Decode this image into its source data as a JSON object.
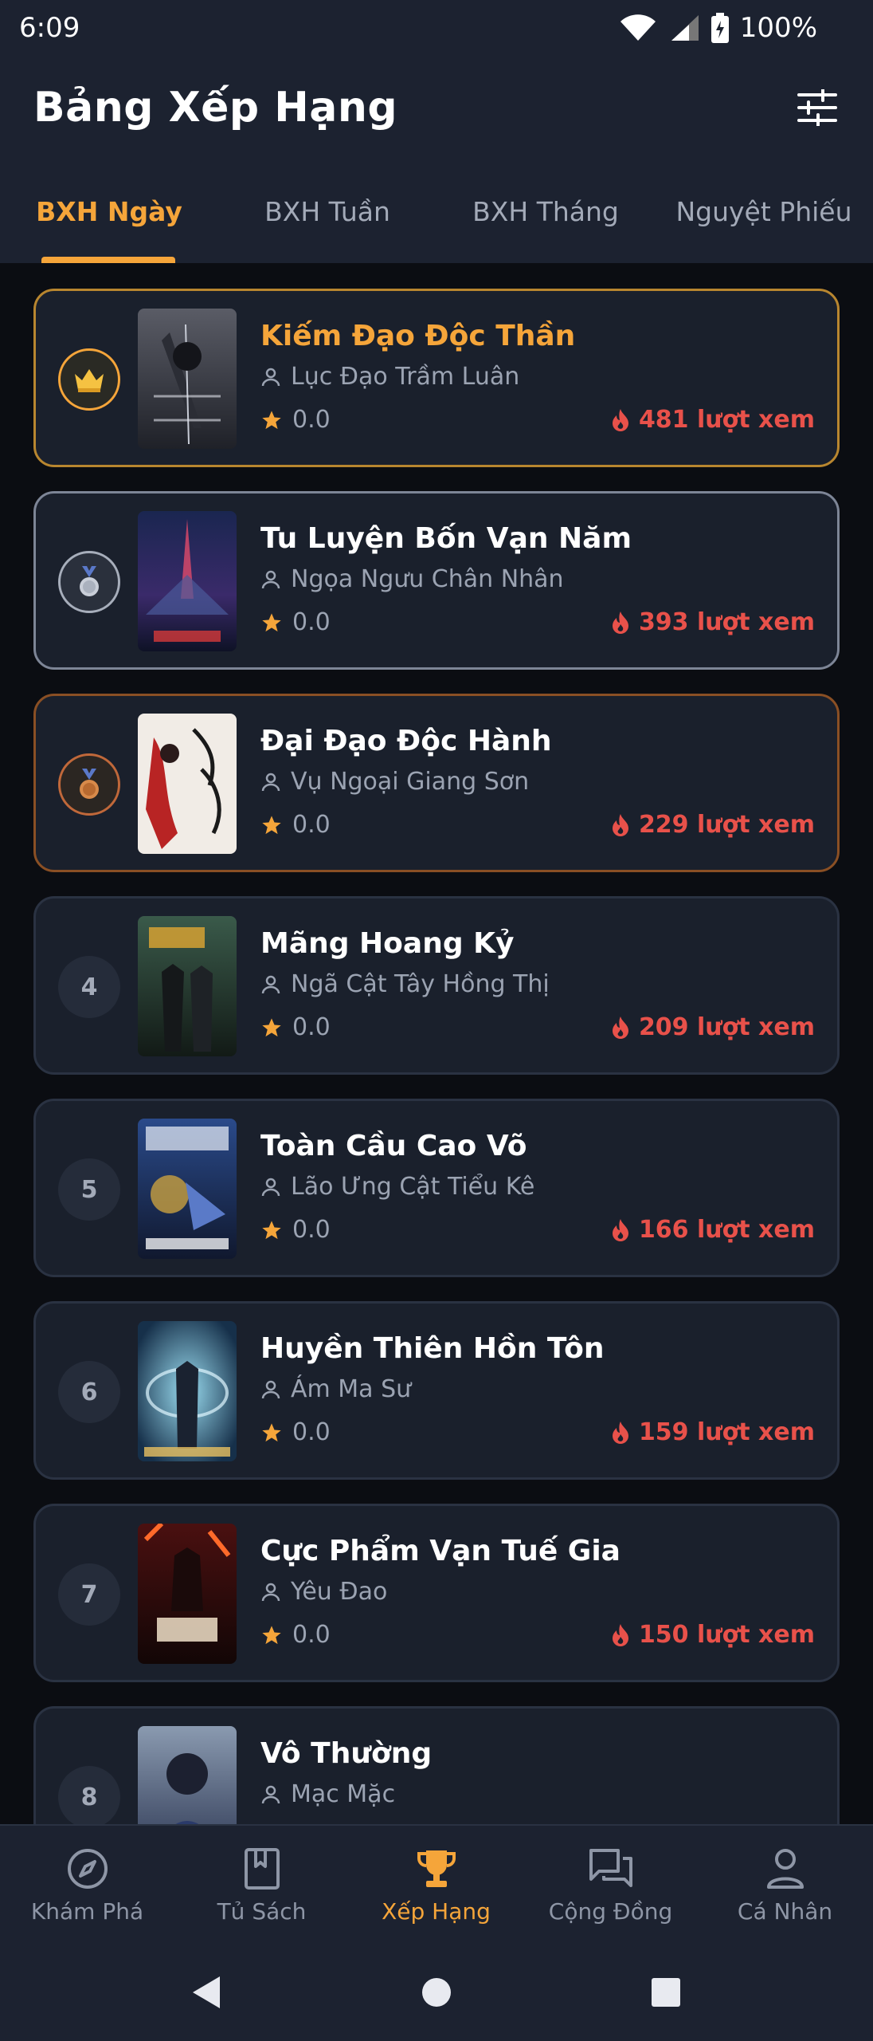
{
  "status": {
    "time": "6:09",
    "battery": "100%"
  },
  "header": {
    "title": "Bảng Xếp Hạng"
  },
  "tabs": [
    {
      "label": "BXH Ngày",
      "active": true
    },
    {
      "label": "BXH Tuần",
      "active": false
    },
    {
      "label": "BXH Tháng",
      "active": false
    },
    {
      "label": "Nguyệt Phiếu",
      "active": false
    }
  ],
  "ranking": [
    {
      "rank": "1",
      "medal": "crown",
      "title": "Kiếm Đạo Độc Thần",
      "author": "Lục Đạo Trầm Luân",
      "rating": "0.0",
      "views": "481 lượt xem"
    },
    {
      "rank": "2",
      "medal": "silver",
      "title": "Tu Luyện Bốn Vạn Năm",
      "author": "Ngọa Ngưu Chân Nhân",
      "rating": "0.0",
      "views": "393 lượt xem"
    },
    {
      "rank": "3",
      "medal": "bronze",
      "title": "Đại Đạo Độc Hành",
      "author": "Vụ Ngoại Giang Sơn",
      "rating": "0.0",
      "views": "229 lượt xem"
    },
    {
      "rank": "4",
      "medal": "",
      "title": "Mãng Hoang Kỷ",
      "author": "Ngã Cật Tây Hồng Thị",
      "rating": "0.0",
      "views": "209 lượt xem"
    },
    {
      "rank": "5",
      "medal": "",
      "title": "Toàn Cầu Cao Võ",
      "author": "Lão Ưng Cật Tiểu Kê",
      "rating": "0.0",
      "views": "166 lượt xem"
    },
    {
      "rank": "6",
      "medal": "",
      "title": "Huyền Thiên Hồn Tôn",
      "author": "Ám Ma Sư",
      "rating": "0.0",
      "views": "159 lượt xem"
    },
    {
      "rank": "7",
      "medal": "",
      "title": "Cực Phẩm Vạn Tuế Gia",
      "author": "Yêu Đao",
      "rating": "0.0",
      "views": "150 lượt xem"
    },
    {
      "rank": "8",
      "medal": "",
      "title": "Vô Thường",
      "author": "Mạc Mặc",
      "rating": "",
      "views": ""
    }
  ],
  "bottom_nav": [
    {
      "label": "Khám Phá",
      "icon": "compass-icon",
      "active": false
    },
    {
      "label": "Tủ Sách",
      "icon": "bookmark-book-icon",
      "active": false
    },
    {
      "label": "Xếp Hạng",
      "icon": "trophy-icon",
      "active": true
    },
    {
      "label": "Cộng Đồng",
      "icon": "forum-icon",
      "active": false
    },
    {
      "label": "Cá Nhân",
      "icon": "person-icon",
      "active": false
    }
  ],
  "colors": {
    "accent": "#f5a53a",
    "views": "#e8514a",
    "background": "#0b0d12",
    "surface": "#1c2230",
    "card": "#1a202c"
  }
}
